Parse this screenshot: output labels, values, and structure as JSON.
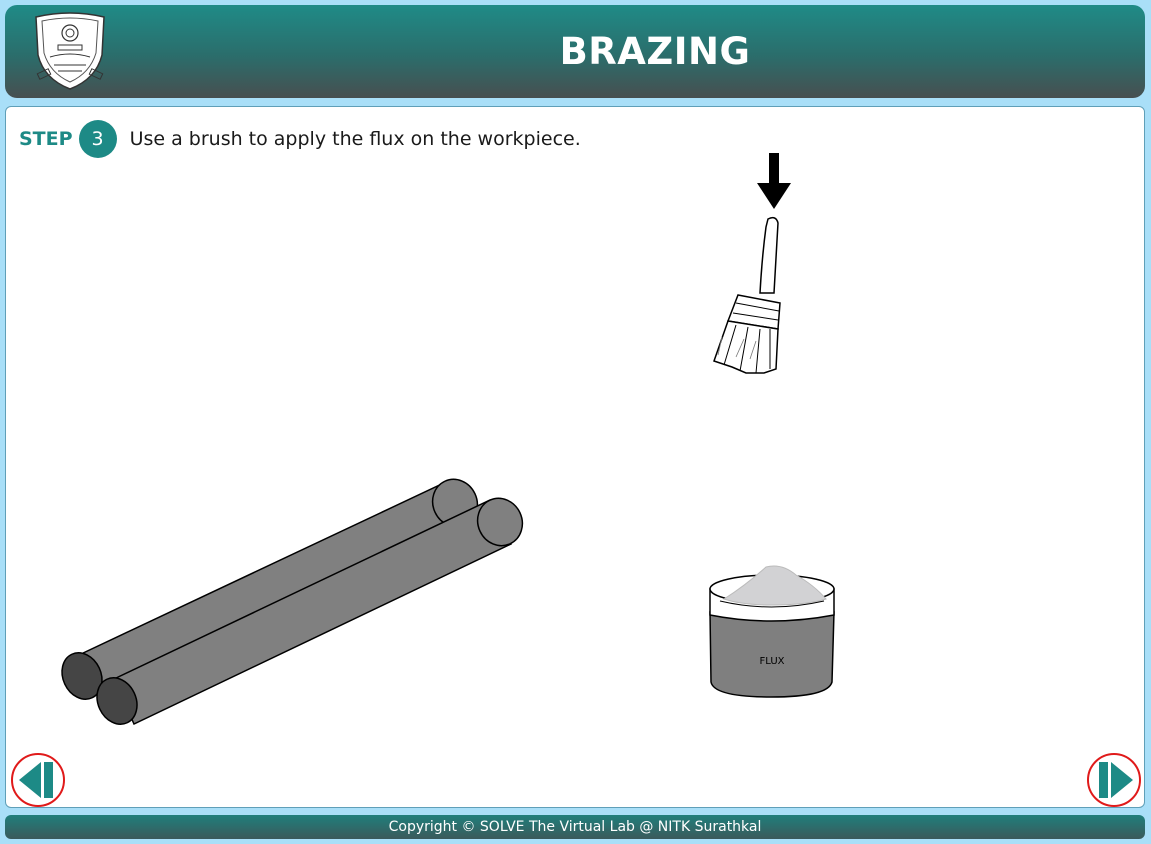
{
  "header": {
    "title": "BRAZING",
    "logo_icon": "nitk-emblem-icon"
  },
  "step": {
    "label": "STEP",
    "number": "3",
    "instruction": "Use a brush to apply the flux on the workpiece."
  },
  "scene": {
    "flux_label": "FLUX",
    "colors": {
      "rod_fill": "#808080",
      "rod_end": "#454545",
      "jar_body": "#7f7f7f",
      "powder": "#d2d2d4"
    }
  },
  "navigation": {
    "prev_icon": "previous-step-icon",
    "next_icon": "next-step-icon",
    "button_accent": "#1d8a86",
    "ring_color": "#e01a1a"
  },
  "footer": {
    "copyright": "Copyright © SOLVE The Virtual Lab @ NITK Surathkal"
  }
}
